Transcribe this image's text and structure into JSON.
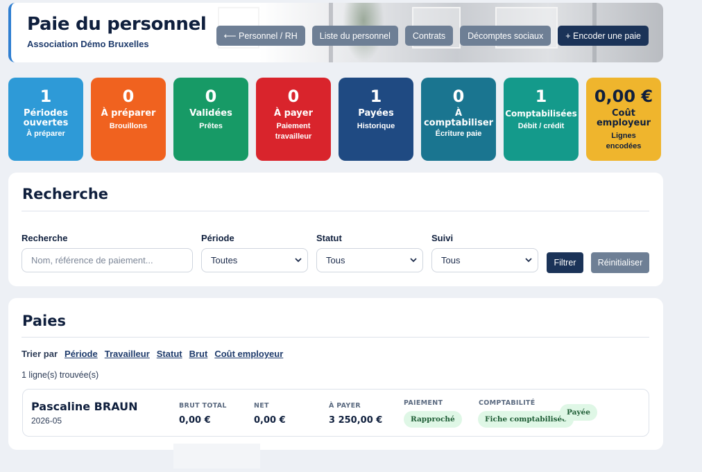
{
  "header": {
    "title": "Paie du personnel",
    "subtitle": "Association Démo Bruxelles",
    "nav": [
      {
        "label": "⟵ Personnel / RH"
      },
      {
        "label": "Liste du personnel"
      },
      {
        "label": "Contrats"
      },
      {
        "label": "Décomptes sociaux"
      },
      {
        "label": "+ Encoder une paie"
      }
    ]
  },
  "kpis": [
    {
      "value": "1",
      "label": "Périodes ouvertes",
      "sub": "À préparer",
      "color": "#2e9ad7"
    },
    {
      "value": "0",
      "label": "À préparer",
      "sub": "Brouillons",
      "color": "#f0621f"
    },
    {
      "value": "0",
      "label": "Validées",
      "sub": "Prêtes",
      "color": "#179a66"
    },
    {
      "value": "0",
      "label": "À payer",
      "sub": "Paiement travailleur",
      "color": "#d9242c"
    },
    {
      "value": "1",
      "label": "Payées",
      "sub": "Historique",
      "color": "#1f4a82"
    },
    {
      "value": "0",
      "label": "À comptabiliser",
      "sub": "Écriture paie",
      "color": "#1a7590"
    },
    {
      "value": "1",
      "label": "Comptabilisées",
      "sub": "Débit / crédit",
      "color": "#149a8b"
    },
    {
      "value": "0,00 €",
      "label": "Coût employeur",
      "sub": "Lignes encodées",
      "color": "#efb52d"
    }
  ],
  "search": {
    "title": "Recherche",
    "fields": {
      "query": {
        "label": "Recherche",
        "placeholder": "Nom, référence de paiement..."
      },
      "period": {
        "label": "Période",
        "value": "Toutes"
      },
      "status": {
        "label": "Statut",
        "value": "Tous"
      },
      "follow": {
        "label": "Suivi",
        "value": "Tous"
      }
    },
    "filter_label": "Filtrer",
    "reset_label": "Réinitialiser"
  },
  "pays": {
    "title": "Paies",
    "sort_label": "Trier par",
    "sort_links": [
      "Période",
      "Travailleur",
      "Statut",
      "Brut",
      "Coût employeur"
    ],
    "count_text": "1 ligne(s) trouvée(s)",
    "rows": [
      {
        "name": "Pascaline BRAUN",
        "period": "2026-05",
        "brut_header": "BRUT TOTAL",
        "brut": "0,00 €",
        "net_header": "NET",
        "net": "0,00 €",
        "apayer_header": "À PAYER",
        "apayer": "3 250,00 €",
        "paiement_header": "PAIEMENT",
        "paiement": "Rapproché",
        "compta_header": "COMPTABILITÉ",
        "compta": "Fiche comptabilisée",
        "statut": "Payée"
      }
    ]
  },
  "colors": {
    "accent": "#1b3358",
    "muted_button": "#6e7f95",
    "pill_bg": "#dff7e6"
  }
}
